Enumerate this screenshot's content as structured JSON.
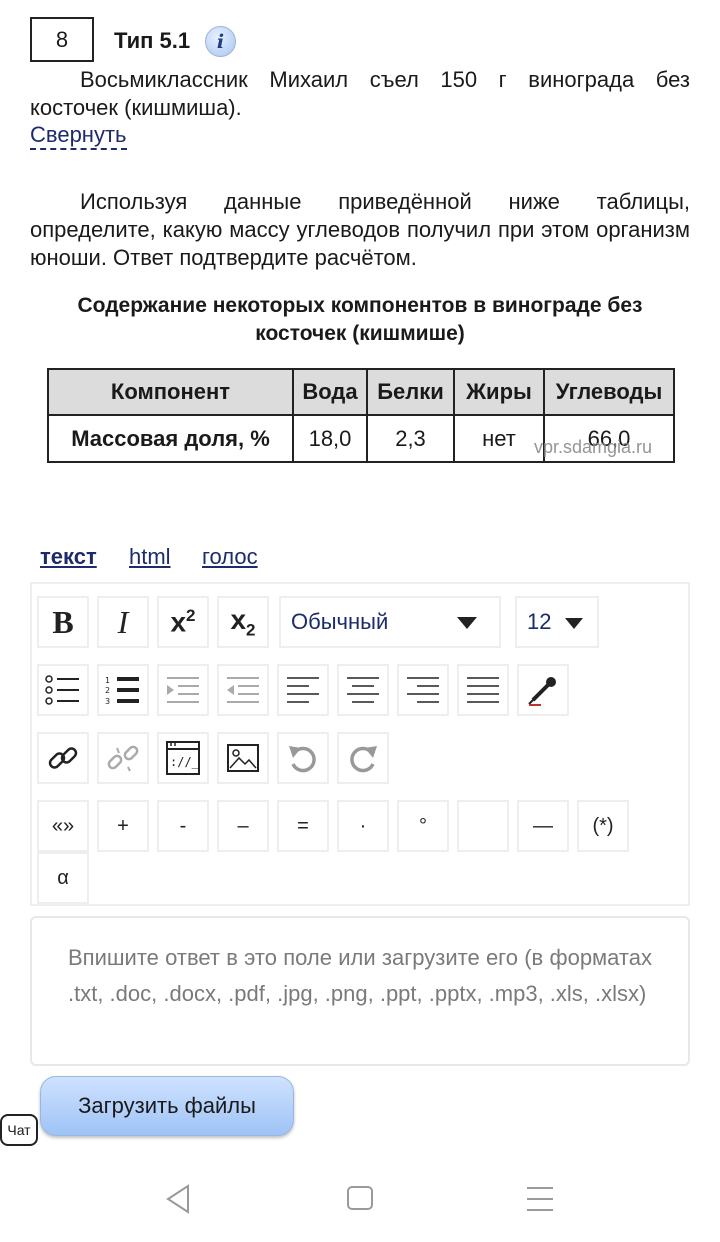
{
  "task": {
    "number": "8",
    "type": "Тип 5.1",
    "info_icon": "i",
    "intro": "Восьмиклассник Михаил съел 150 г винограда без косточек (кишмиша).",
    "collapse_label": "Свернуть",
    "question": "Используя данные приведённой ниже таблицы, определите, какую массу углеводов получил при этом организм юноши. Ответ подтвердите расчётом.",
    "table_title": "Содержание некоторых компонентов в винограде без косточек (кишмише)",
    "table": {
      "headers": [
        "Компонент",
        "Вода",
        "Белки",
        "Жиры",
        "Углеводы"
      ],
      "row": [
        "Массовая доля, %",
        "18,0",
        "2,3",
        "нет",
        "66,0"
      ]
    },
    "watermark": "vpr.sdamgia.ru"
  },
  "mode_tabs": [
    {
      "label": "текст",
      "active": true
    },
    {
      "label": "html",
      "active": false
    },
    {
      "label": "голос",
      "active": false
    }
  ],
  "toolbar": {
    "format_select": "Обычный",
    "font_size_select": "12",
    "symbols": [
      "«»",
      "+",
      "-",
      "–",
      "=",
      "·",
      "°",
      "",
      "—",
      "(*)",
      "α"
    ]
  },
  "answer": {
    "placeholder": "Впишите ответ в это поле или загрузите его (в форматах .txt, .doc, .docx, .pdf, .jpg, .png, .ppt, .pptx, .mp3, .xls, .xlsx)"
  },
  "upload_button": "Загрузить файлы",
  "chat_button": "Чат",
  "colors": {
    "link": "#1d2b6b",
    "button_gradient_top": "#cfe2ff",
    "button_gradient_bottom": "#9ec3f6",
    "table_header_bg": "#dcdcdc"
  }
}
